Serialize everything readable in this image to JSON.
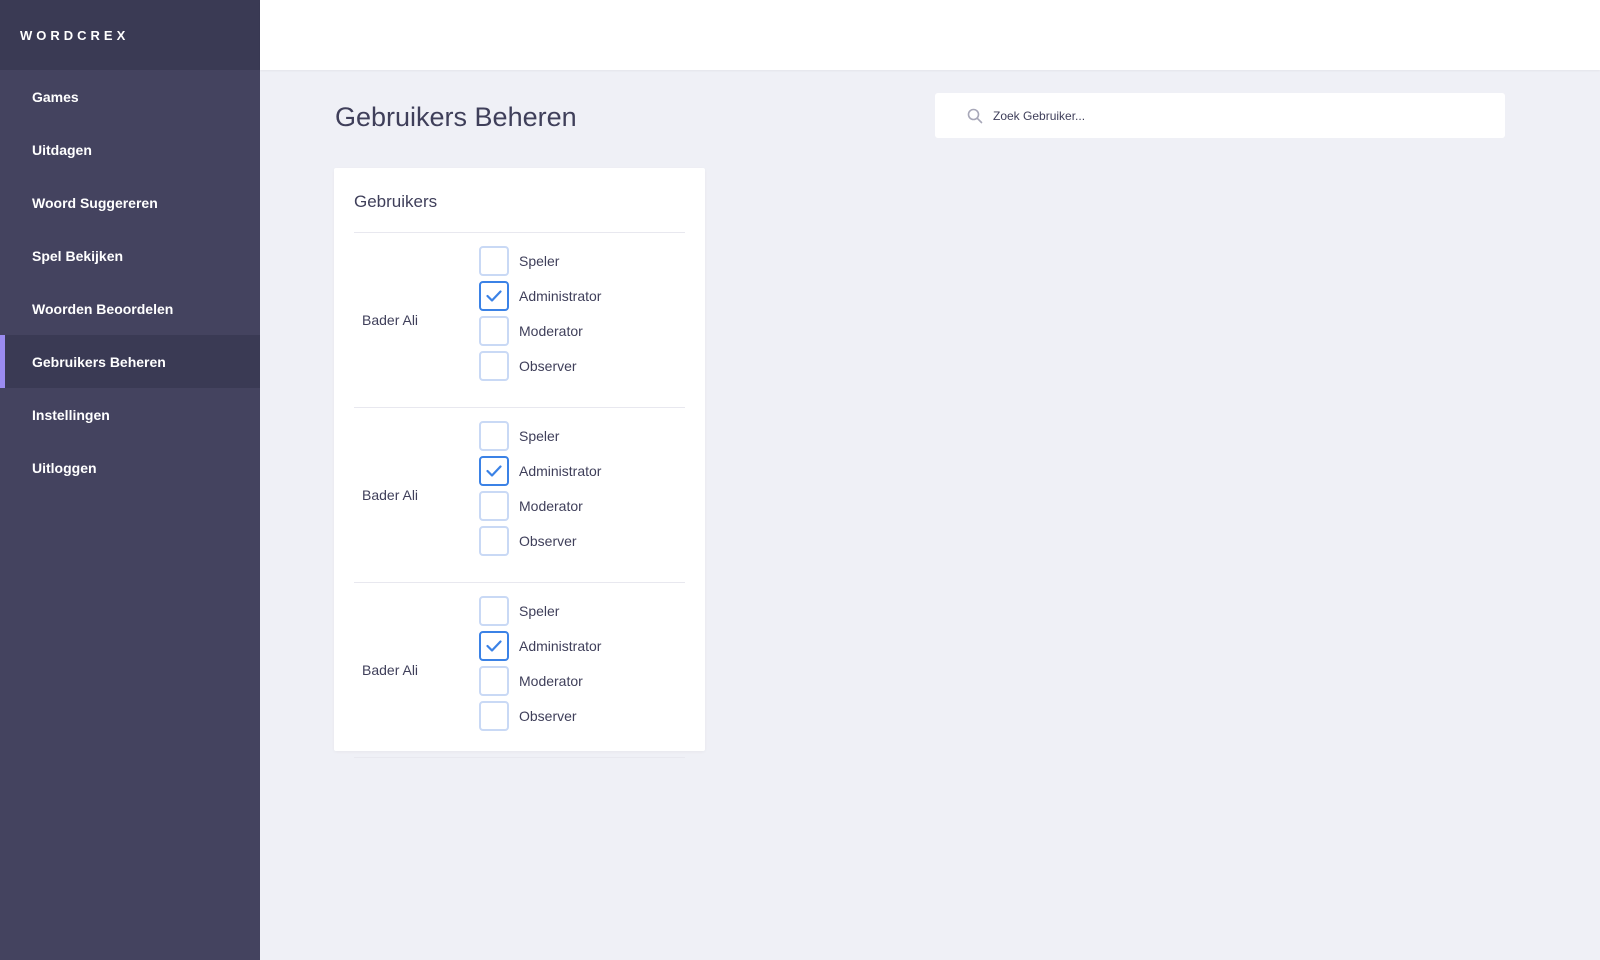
{
  "app": {
    "brand": "WORDCREX"
  },
  "sidebar": {
    "items": [
      {
        "label": "Games",
        "active": false
      },
      {
        "label": "Uitdagen",
        "active": false
      },
      {
        "label": "Woord Suggereren",
        "active": false
      },
      {
        "label": "Spel Bekijken",
        "active": false
      },
      {
        "label": "Woorden Beoordelen",
        "active": false
      },
      {
        "label": "Gebruikers Beheren",
        "active": true
      },
      {
        "label": "Instellingen",
        "active": false
      },
      {
        "label": "Uitloggen",
        "active": false
      }
    ]
  },
  "main": {
    "title": "Gebruikers Beheren",
    "search": {
      "placeholder": "Zoek Gebruiker...",
      "value": ""
    },
    "card": {
      "title": "Gebruikers",
      "users": [
        {
          "name": "Bader Ali",
          "roles": [
            {
              "label": "Speler",
              "checked": false
            },
            {
              "label": "Administrator",
              "checked": true
            },
            {
              "label": "Moderator",
              "checked": false
            },
            {
              "label": "Observer",
              "checked": false
            }
          ]
        },
        {
          "name": "Bader Ali",
          "roles": [
            {
              "label": "Speler",
              "checked": false
            },
            {
              "label": "Administrator",
              "checked": true
            },
            {
              "label": "Moderator",
              "checked": false
            },
            {
              "label": "Observer",
              "checked": false
            }
          ]
        },
        {
          "name": "Bader Ali",
          "roles": [
            {
              "label": "Speler",
              "checked": false
            },
            {
              "label": "Administrator",
              "checked": true
            },
            {
              "label": "Moderator",
              "checked": false
            },
            {
              "label": "Observer",
              "checked": false
            }
          ]
        }
      ]
    }
  },
  "colors": {
    "sidebar": "#44435f",
    "sidebar_active": "#3a3a54",
    "accent": "#9b8cf0",
    "checkbox_checked": "#3b82e6",
    "checkbox_unchecked": "#c9d9f5",
    "background": "#eff0f6"
  },
  "icons": {
    "search": "search-icon",
    "check": "checkmark-icon"
  }
}
